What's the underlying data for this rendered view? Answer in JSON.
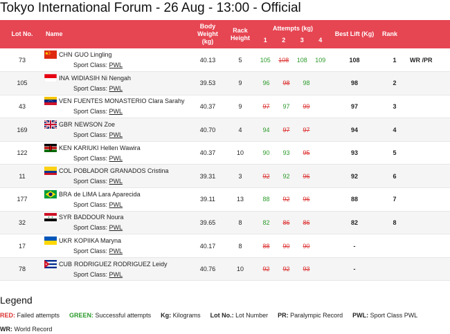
{
  "title": "Tokyo International Forum - 26 Aug - 13:00 - Official",
  "headers": {
    "lot": "Lot No.",
    "name": "Name",
    "body_weight": [
      "Body",
      "Weight (kg)"
    ],
    "rack_height": [
      "Rack",
      "Height"
    ],
    "attempts": "Attempts (kg)",
    "attempt_numbers": [
      "1",
      "2",
      "3",
      "4"
    ],
    "best_lift": "Best Lift (Kg)",
    "rank": "Rank"
  },
  "class_label": "Sport Class:",
  "class_value": "PWL",
  "colors": {
    "header": "#e64552",
    "good": "#2a9a2a",
    "fail": "#d33"
  },
  "rows": [
    {
      "lot": "73",
      "noc": "CHN",
      "flag": "chn",
      "name": "GUO Lingling",
      "bw": "40.13",
      "rack": "5",
      "a1": "105",
      "a1s": "good",
      "a2": "108",
      "a2s": "fail",
      "a3": "108",
      "a3s": "good",
      "a4": "109",
      "a4s": "good",
      "best": "108",
      "rank": "1",
      "rec1": "WR",
      "rec2": "/PR"
    },
    {
      "lot": "105",
      "noc": "INA",
      "flag": "ina",
      "name": "WIDIASIH Ni Nengah",
      "bw": "39.53",
      "rack": "9",
      "a1": "96",
      "a1s": "good",
      "a2": "98",
      "a2s": "fail",
      "a3": "98",
      "a3s": "good",
      "a4": "",
      "a4s": "",
      "best": "98",
      "rank": "2",
      "rec1": "",
      "rec2": ""
    },
    {
      "lot": "43",
      "noc": "VEN",
      "flag": "ven",
      "name": "FUENTES MONASTERIO Clara Sarahy",
      "bw": "40.37",
      "rack": "9",
      "a1": "97",
      "a1s": "fail",
      "a2": "97",
      "a2s": "good",
      "a3": "99",
      "a3s": "fail",
      "a4": "",
      "a4s": "",
      "best": "97",
      "rank": "3",
      "rec1": "",
      "rec2": ""
    },
    {
      "lot": "169",
      "noc": "GBR",
      "flag": "gbr",
      "name": "NEWSON Zoe",
      "bw": "40.70",
      "rack": "4",
      "a1": "94",
      "a1s": "good",
      "a2": "97",
      "a2s": "fail",
      "a3": "97",
      "a3s": "fail",
      "a4": "",
      "a4s": "",
      "best": "94",
      "rank": "4",
      "rec1": "",
      "rec2": ""
    },
    {
      "lot": "122",
      "noc": "KEN",
      "flag": "ken",
      "name": "KARIUKI Hellen Wawira",
      "bw": "40.37",
      "rack": "10",
      "a1": "90",
      "a1s": "good",
      "a2": "93",
      "a2s": "good",
      "a3": "95",
      "a3s": "fail",
      "a4": "",
      "a4s": "",
      "best": "93",
      "rank": "5",
      "rec1": "",
      "rec2": ""
    },
    {
      "lot": "11",
      "noc": "COL",
      "flag": "col",
      "name": "POBLADOR GRANADOS Cristina",
      "bw": "39.31",
      "rack": "3",
      "a1": "92",
      "a1s": "fail",
      "a2": "92",
      "a2s": "good",
      "a3": "96",
      "a3s": "fail",
      "a4": "",
      "a4s": "",
      "best": "92",
      "rank": "6",
      "rec1": "",
      "rec2": ""
    },
    {
      "lot": "177",
      "noc": "BRA",
      "flag": "bra",
      "name": "de LIMA Lara Aparecida",
      "bw": "39.11",
      "rack": "13",
      "a1": "88",
      "a1s": "good",
      "a2": "92",
      "a2s": "fail",
      "a3": "96",
      "a3s": "fail",
      "a4": "",
      "a4s": "",
      "best": "88",
      "rank": "7",
      "rec1": "",
      "rec2": ""
    },
    {
      "lot": "32",
      "noc": "SYR",
      "flag": "syr",
      "name": "BADDOUR Noura",
      "bw": "39.65",
      "rack": "8",
      "a1": "82",
      "a1s": "good",
      "a2": "86",
      "a2s": "fail",
      "a3": "86",
      "a3s": "fail",
      "a4": "",
      "a4s": "",
      "best": "82",
      "rank": "8",
      "rec1": "",
      "rec2": ""
    },
    {
      "lot": "17",
      "noc": "UKR",
      "flag": "ukr",
      "name": "KOPIIKA Maryna",
      "bw": "40.17",
      "rack": "8",
      "a1": "88",
      "a1s": "fail",
      "a2": "90",
      "a2s": "fail",
      "a3": "90",
      "a3s": "fail",
      "a4": "",
      "a4s": "",
      "best": "-",
      "rank": "",
      "rec1": "",
      "rec2": ""
    },
    {
      "lot": "78",
      "noc": "CUB",
      "flag": "cub",
      "name": "RODRIGUEZ RODRIGUEZ Leidy",
      "bw": "40.76",
      "rack": "10",
      "a1": "92",
      "a1s": "fail",
      "a2": "92",
      "a2s": "fail",
      "a3": "93",
      "a3s": "fail",
      "a4": "",
      "a4s": "",
      "best": "-",
      "rank": "",
      "rec1": "",
      "rec2": ""
    }
  ],
  "legend": {
    "title": "Legend",
    "items": [
      {
        "key": "RED:",
        "text": " Failed attempts",
        "style": "red"
      },
      {
        "key": "GREEN:",
        "text": " Successful attempts",
        "style": "green"
      },
      {
        "key": "Kg:",
        "text": " Kilograms",
        "style": "bold"
      },
      {
        "key": "Lot No.:",
        "text": " Lot Number",
        "style": "bold"
      },
      {
        "key": "PR:",
        "text": " Paralympic Record",
        "style": "bold"
      },
      {
        "key": "PWL:",
        "text": " Sport Class PWL",
        "style": "bold"
      }
    ],
    "items2": [
      {
        "key": "WR:",
        "text": " World Record",
        "style": "bold"
      }
    ]
  }
}
